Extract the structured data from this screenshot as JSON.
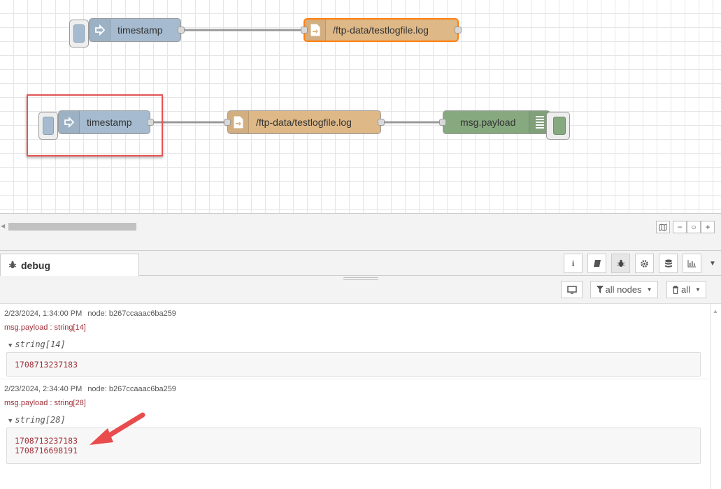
{
  "flows": {
    "row1": {
      "inject_label": "timestamp",
      "file_label": "/ftp-data/testlogfile.log"
    },
    "row2": {
      "inject_label": "timestamp",
      "file_label": "/ftp-data/testlogfile.log",
      "debug_label": "msg.payload"
    },
    "colors": {
      "inject": "#a6bbcf",
      "file": "#deb887",
      "debug": "#87a980",
      "selected": "#ff7f0e",
      "highlight": "#e45454"
    }
  },
  "sidebar": {
    "tab_label": "debug",
    "tools": [
      "info-icon",
      "book-icon",
      "bug-icon",
      "gear-icon",
      "database-icon",
      "chart-icon"
    ],
    "filter_nodes_label": "all nodes",
    "clear_label": "all"
  },
  "debug_messages": [
    {
      "timestamp": "2/23/2024, 1:34:00 PM",
      "node": "node: b267ccaaac6ba259",
      "topic": "msg.payload : string[14]",
      "type": "string[14]",
      "lines": [
        "1708713237183"
      ]
    },
    {
      "timestamp": "2/23/2024, 2:34:40 PM",
      "node": "node: b267ccaaac6ba259",
      "topic": "msg.payload : string[28]",
      "type": "string[28]",
      "lines": [
        "1708713237183",
        "1708716698191"
      ]
    }
  ]
}
